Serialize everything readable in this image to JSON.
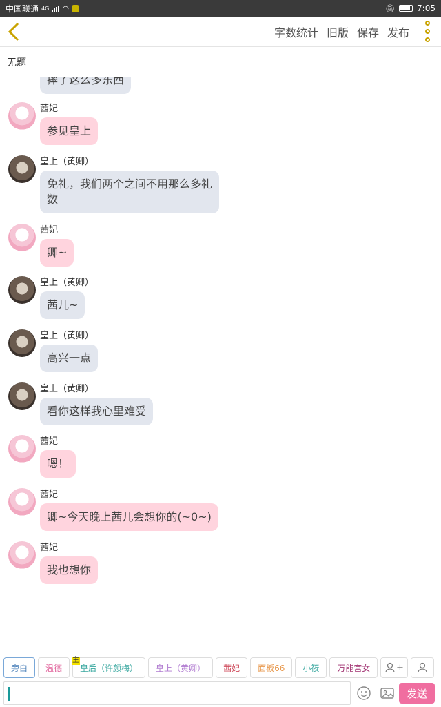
{
  "status": {
    "carrier": "中国联通",
    "network": "4G",
    "time": "7:05"
  },
  "toolbar": {
    "word_count": "字数统计",
    "old_version": "旧版",
    "save": "保存",
    "publish": "发布"
  },
  "doc_title": "无题",
  "partial_message": "摔了这么多东西",
  "messages": [
    {
      "sender": "茜妃",
      "text": "参见皇上",
      "style": "pink"
    },
    {
      "sender": "皇上（黄卿）",
      "text": "免礼，我们两个之间不用那么多礼数",
      "style": "gray"
    },
    {
      "sender": "茜妃",
      "text": "卿~",
      "style": "pink"
    },
    {
      "sender": "皇上（黄卿）",
      "text": "茜儿~",
      "style": "gray"
    },
    {
      "sender": "皇上（黄卿）",
      "text": "高兴一点",
      "style": "gray"
    },
    {
      "sender": "皇上（黄卿）",
      "text": "看你这样我心里难受",
      "style": "gray"
    },
    {
      "sender": "茜妃",
      "text": "嗯！",
      "style": "pink"
    },
    {
      "sender": "茜妃",
      "text": "卿~今天晚上茜儿会想你的(~0~)",
      "style": "pink"
    },
    {
      "sender": "茜妃",
      "text": "我也想你",
      "style": "pink"
    }
  ],
  "roles": [
    {
      "label": "旁白",
      "color": "#4a7fb8",
      "selected": true
    },
    {
      "label": "温德",
      "color": "#e0609a"
    },
    {
      "label": "皇后（许颜梅）",
      "color": "#3aa8a0",
      "badge": "主"
    },
    {
      "label": "皇上（黄卿）",
      "color": "#b07ad0"
    },
    {
      "label": "茜妃",
      "color": "#d05060"
    },
    {
      "label": "面板66",
      "color": "#e89a50"
    },
    {
      "label": "小筱",
      "color": "#3aa8a0"
    },
    {
      "label": "万能宫女",
      "color": "#a03070"
    }
  ],
  "add_role_plus": "+",
  "input": {
    "value": ""
  },
  "send_label": "发送"
}
